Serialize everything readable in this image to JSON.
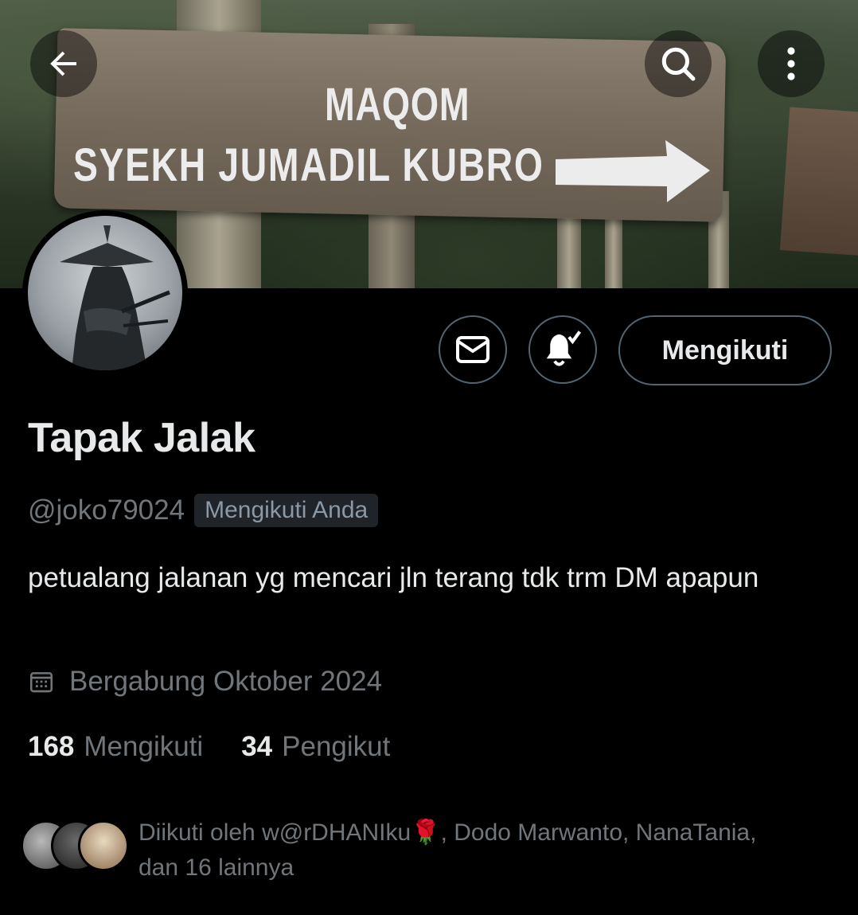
{
  "banner": {
    "sign_line1": "MAQOM",
    "sign_line2": "SYEKH JUMADIL KUBRO"
  },
  "header": {
    "back_icon": "arrow-left-icon",
    "search_icon": "search-icon",
    "more_icon": "more-vertical-icon"
  },
  "actions": {
    "message_icon": "envelope-icon",
    "notify_icon": "bell-check-icon",
    "follow_label": "Mengikuti"
  },
  "profile": {
    "name": "Tapak Jalak",
    "handle": "@joko79024",
    "follows_you": "Mengikuti Anda",
    "bio": "petualang jalanan yg mencari jln terang tdk trm DM apapun",
    "joined_icon": "calendar-icon",
    "joined": "Bergabung Oktober 2024"
  },
  "stats": {
    "following_count": "168",
    "following_label": "Mengikuti",
    "followers_count": "34",
    "followers_label": "Pengikut"
  },
  "followed_by": {
    "prefix": "Diikuti oleh w@rDHANIku",
    "emoji": "🌹",
    "rest": ", Dodo Marwanto, NanaTania,",
    "line2": "dan 16 lainnya"
  },
  "colors": {
    "background": "#000000",
    "text": "#e7e9ea",
    "secondary": "#71767b",
    "border": "#536471"
  }
}
